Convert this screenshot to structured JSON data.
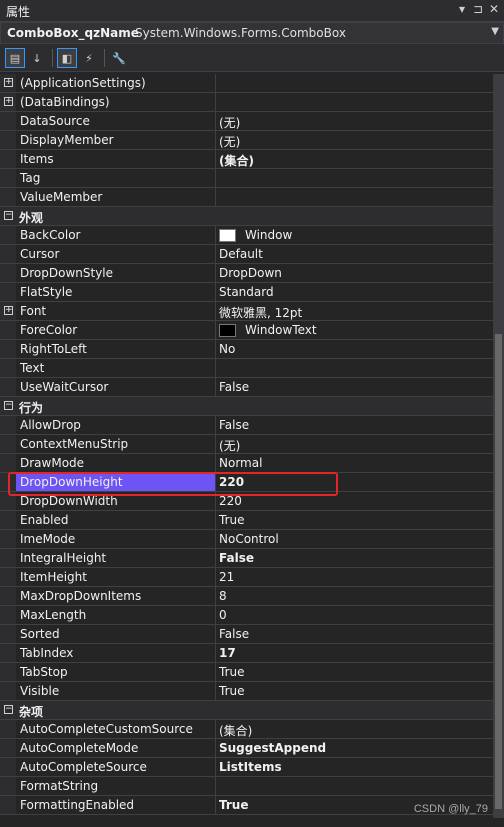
{
  "window": {
    "title": "属性",
    "controls": [
      "▾",
      "⊐",
      "✕"
    ]
  },
  "object_selector": {
    "name": "ComboBox_qzName",
    "type": "System.Windows.Forms.ComboBox"
  },
  "toolbar": {
    "buttons": [
      {
        "icon": "categorized-icon",
        "glyph": "▤",
        "active": true
      },
      {
        "icon": "alphabetical-icon",
        "glyph": "↓",
        "active": false
      },
      {
        "icon": "properties-icon",
        "glyph": "◧",
        "active": true
      },
      {
        "icon": "events-lightning-icon",
        "glyph": "⚡",
        "active": false
      },
      {
        "icon": "property-pages-wrench-icon",
        "glyph": "🔧",
        "active": false
      }
    ]
  },
  "rows": [
    {
      "kind": "prop",
      "expander": "+",
      "name": "(ApplicationSettings)",
      "value": ""
    },
    {
      "kind": "prop",
      "expander": "+",
      "name": "(DataBindings)",
      "value": ""
    },
    {
      "kind": "prop",
      "name": "DataSource",
      "value": "(无)"
    },
    {
      "kind": "prop",
      "name": "DisplayMember",
      "value": "(无)"
    },
    {
      "kind": "prop",
      "name": "Items",
      "value": "(集合)",
      "bold": true
    },
    {
      "kind": "prop",
      "name": "Tag",
      "value": ""
    },
    {
      "kind": "prop",
      "name": "ValueMember",
      "value": ""
    },
    {
      "kind": "cat",
      "expander": "−",
      "name": "外观"
    },
    {
      "kind": "prop",
      "name": "BackColor",
      "value": "Window",
      "swatch": "#ffffff"
    },
    {
      "kind": "prop",
      "name": "Cursor",
      "value": "Default"
    },
    {
      "kind": "prop",
      "name": "DropDownStyle",
      "value": "DropDown"
    },
    {
      "kind": "prop",
      "name": "FlatStyle",
      "value": "Standard"
    },
    {
      "kind": "prop",
      "expander": "+",
      "name": "Font",
      "value": "微软雅黑, 12pt"
    },
    {
      "kind": "prop",
      "name": "ForeColor",
      "value": "WindowText",
      "swatch": "#000000"
    },
    {
      "kind": "prop",
      "name": "RightToLeft",
      "value": "No"
    },
    {
      "kind": "prop",
      "name": "Text",
      "value": ""
    },
    {
      "kind": "prop",
      "name": "UseWaitCursor",
      "value": "False"
    },
    {
      "kind": "cat",
      "expander": "−",
      "name": "行为"
    },
    {
      "kind": "prop",
      "name": "AllowDrop",
      "value": "False"
    },
    {
      "kind": "prop",
      "name": "ContextMenuStrip",
      "value": "(无)"
    },
    {
      "kind": "prop",
      "name": "DrawMode",
      "value": "Normal"
    },
    {
      "kind": "prop",
      "name": "DropDownHeight",
      "value": "220",
      "bold": true,
      "selected": true
    },
    {
      "kind": "prop",
      "name": "DropDownWidth",
      "value": "220"
    },
    {
      "kind": "prop",
      "name": "Enabled",
      "value": "True"
    },
    {
      "kind": "prop",
      "name": "ImeMode",
      "value": "NoControl"
    },
    {
      "kind": "prop",
      "name": "IntegralHeight",
      "value": "False",
      "bold": true
    },
    {
      "kind": "prop",
      "name": "ItemHeight",
      "value": "21"
    },
    {
      "kind": "prop",
      "name": "MaxDropDownItems",
      "value": "8"
    },
    {
      "kind": "prop",
      "name": "MaxLength",
      "value": "0"
    },
    {
      "kind": "prop",
      "name": "Sorted",
      "value": "False"
    },
    {
      "kind": "prop",
      "name": "TabIndex",
      "value": "17",
      "bold": true
    },
    {
      "kind": "prop",
      "name": "TabStop",
      "value": "True"
    },
    {
      "kind": "prop",
      "name": "Visible",
      "value": "True"
    },
    {
      "kind": "cat",
      "expander": "−",
      "name": "杂项"
    },
    {
      "kind": "prop",
      "name": "AutoCompleteCustomSource",
      "value": "(集合)"
    },
    {
      "kind": "prop",
      "name": "AutoCompleteMode",
      "value": "SuggestAppend",
      "bold": true
    },
    {
      "kind": "prop",
      "name": "AutoCompleteSource",
      "value": "ListItems",
      "bold": true
    },
    {
      "kind": "prop",
      "name": "FormatString",
      "value": ""
    },
    {
      "kind": "prop",
      "name": "FormattingEnabled",
      "value": "True",
      "bold": true
    }
  ],
  "watermark": "CSDN @lly_79",
  "colors": {
    "selection": "#6e54f5",
    "highlight_box": "#e0262b",
    "background": "#252526"
  }
}
